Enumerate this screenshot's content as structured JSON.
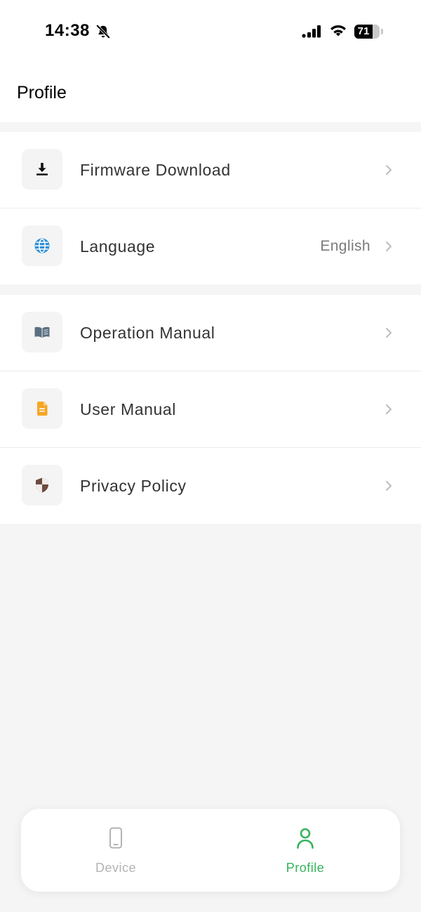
{
  "status_bar": {
    "time": "14:38",
    "battery": 71,
    "battery_label": "71",
    "icons": [
      "bell-muted-icon",
      "signal-icon",
      "wifi-icon",
      "battery-icon"
    ]
  },
  "header": {
    "title": "Profile"
  },
  "menu": {
    "groups": [
      {
        "items": [
          {
            "label": "Firmware Download",
            "icon": "download-icon",
            "value": ""
          },
          {
            "label": "Language",
            "icon": "globe-icon",
            "value": "English"
          }
        ]
      },
      {
        "items": [
          {
            "label": "Operation Manual",
            "icon": "book-icon",
            "value": ""
          },
          {
            "label": "User Manual",
            "icon": "document-icon",
            "value": ""
          },
          {
            "label": "Privacy Policy",
            "icon": "shield-icon",
            "value": ""
          }
        ]
      }
    ]
  },
  "tab_bar": {
    "tabs": [
      {
        "label": "Device",
        "icon": "phone-icon",
        "active": false
      },
      {
        "label": "Profile",
        "icon": "person-icon",
        "active": true
      }
    ]
  },
  "colors": {
    "accent": "#34b35a",
    "inactive_tab": "#b3b3b3",
    "background": "#f5f5f5",
    "globe_icon": "#2e8fd6",
    "document_icon": "#f5a623",
    "shield_icon": "#6d4a3e",
    "book_icon": "#5b6f80"
  }
}
